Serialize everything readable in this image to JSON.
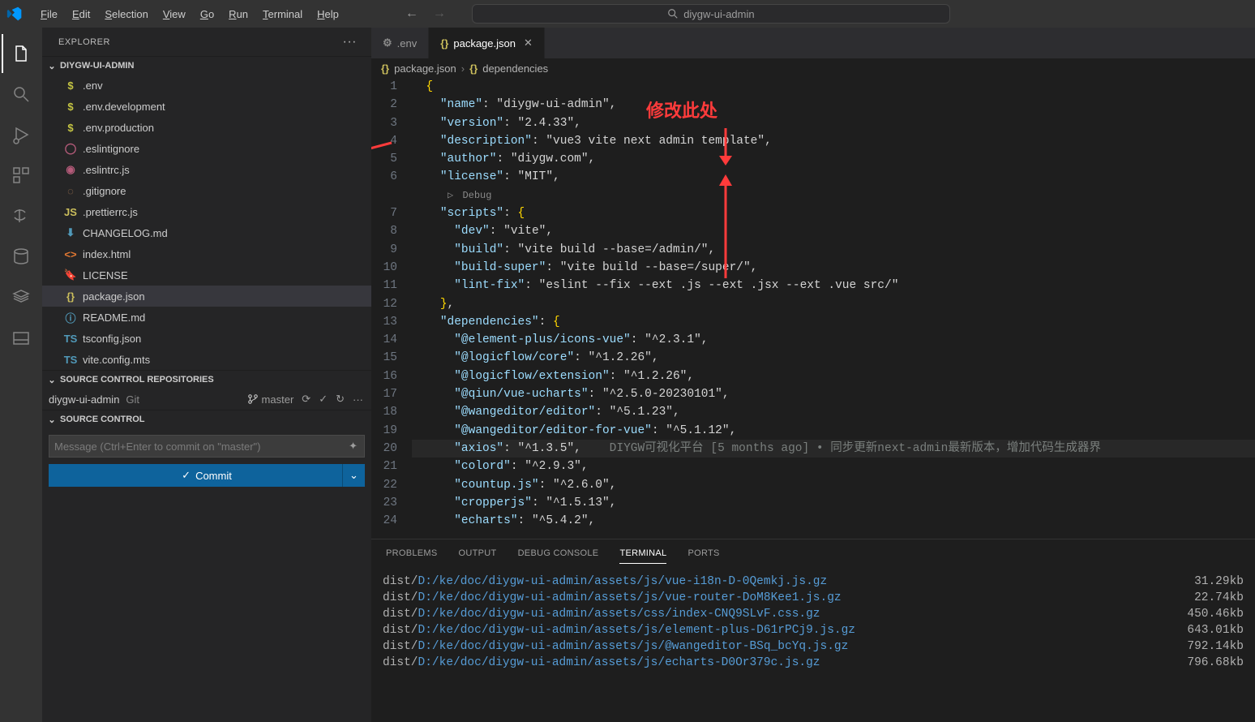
{
  "menu": [
    "File",
    "Edit",
    "Selection",
    "View",
    "Go",
    "Run",
    "Terminal",
    "Help"
  ],
  "cmdcenter": "diygw-ui-admin",
  "explorer": {
    "title": "EXPLORER",
    "project": "DIYGW-UI-ADMIN",
    "files": [
      {
        "icon": "$",
        "color": "#c5c543",
        "name": ".env"
      },
      {
        "icon": "$",
        "color": "#c5c543",
        "name": ".env.development"
      },
      {
        "icon": "$",
        "color": "#c5c543",
        "name": ".env.production"
      },
      {
        "icon": "◯",
        "color": "#b55b7a",
        "name": ".eslintignore"
      },
      {
        "icon": "◉",
        "color": "#b55b7a",
        "name": ".eslintrc.js"
      },
      {
        "icon": "◌",
        "color": "#a97a54",
        "name": ".gitignore"
      },
      {
        "icon": "JS",
        "color": "#cbbe5c",
        "name": ".prettierrc.js"
      },
      {
        "icon": "⬇",
        "color": "#519aba",
        "name": "CHANGELOG.md"
      },
      {
        "icon": "<>",
        "color": "#e37933",
        "name": "index.html"
      },
      {
        "icon": "🔖",
        "color": "#d4bd6a",
        "name": "LICENSE"
      },
      {
        "icon": "{}",
        "color": "#cbbe5c",
        "name": "package.json",
        "sel": true
      },
      {
        "icon": "ⓘ",
        "color": "#519aba",
        "name": "README.md"
      },
      {
        "icon": "TS",
        "color": "#519aba",
        "name": "tsconfig.json"
      },
      {
        "icon": "TS",
        "color": "#519aba",
        "name": "vite.config.mts"
      }
    ],
    "scr_title": "SOURCE CONTROL REPOSITORIES",
    "scr_repo": "diygw-ui-admin",
    "scr_git": "Git",
    "scr_branch": "master",
    "sc_title": "SOURCE CONTROL",
    "sc_placeholder": "Message (Ctrl+Enter to commit on \"master\")",
    "commit_btn": "Commit"
  },
  "tabs": [
    {
      "icon": "⚙",
      "name": ".env",
      "active": false
    },
    {
      "icon": "{}",
      "name": "package.json",
      "active": true
    }
  ],
  "breadcrumb": [
    "package.json",
    "dependencies"
  ],
  "codelens": "Debug",
  "annotation": "修改此处",
  "blame": "DIYGW可视化平台 [5 months ago] • 同步更新next-admin最新版本，增加代码生成器界",
  "code_lines": [
    "{",
    "  \"name\": \"diygw-ui-admin\",",
    "  \"version\": \"2.4.33\",",
    "  \"description\": \"vue3 vite next admin template\",",
    "  \"author\": \"diygw.com\",",
    "  \"license\": \"MIT\",",
    "  \"scripts\": {",
    "    \"dev\": \"vite\",",
    "    \"build\": \"vite build --base=/admin/\",",
    "    \"build-super\": \"vite build --base=/super/\",",
    "    \"lint-fix\": \"eslint --fix --ext .js --ext .jsx --ext .vue src/\"",
    "  },",
    "  \"dependencies\": {",
    "    \"@element-plus/icons-vue\": \"^2.3.1\",",
    "    \"@logicflow/core\": \"^1.2.26\",",
    "    \"@logicflow/extension\": \"^1.2.26\",",
    "    \"@qiun/vue-ucharts\": \"^2.5.0-20230101\",",
    "    \"@wangeditor/editor\": \"^5.1.23\",",
    "    \"@wangeditor/editor-for-vue\": \"^5.1.12\",",
    "    \"axios\": \"^1.3.5\",",
    "    \"colord\": \"^2.9.3\",",
    "    \"countup.js\": \"^2.6.0\",",
    "    \"cropperjs\": \"^1.5.13\",",
    "    \"echarts\": \"^5.4.2\","
  ],
  "panel": {
    "tabs": [
      "PROBLEMS",
      "OUTPUT",
      "DEBUG CONSOLE",
      "TERMINAL",
      "PORTS"
    ],
    "active": "TERMINAL",
    "lines": [
      {
        "p": "D:/ke/doc/diygw-ui-admin/assets/js/vue-i18n-D-0Qemkj.js.gz",
        "sz": "31.29kb"
      },
      {
        "p": "D:/ke/doc/diygw-ui-admin/assets/js/vue-router-DoM8Kee1.js.gz",
        "sz": "22.74kb"
      },
      {
        "p": "D:/ke/doc/diygw-ui-admin/assets/css/index-CNQ9SLvF.css.gz",
        "sz": "450.46kb"
      },
      {
        "p": "D:/ke/doc/diygw-ui-admin/assets/js/element-plus-D61rPCj9.js.gz",
        "sz": "643.01kb"
      },
      {
        "p": "D:/ke/doc/diygw-ui-admin/assets/js/@wangeditor-BSq_bcYq.js.gz",
        "sz": "792.14kb"
      },
      {
        "p": "D:/ke/doc/diygw-ui-admin/assets/js/echarts-D0Or379c.js.gz",
        "sz": "796.68kb"
      }
    ]
  }
}
